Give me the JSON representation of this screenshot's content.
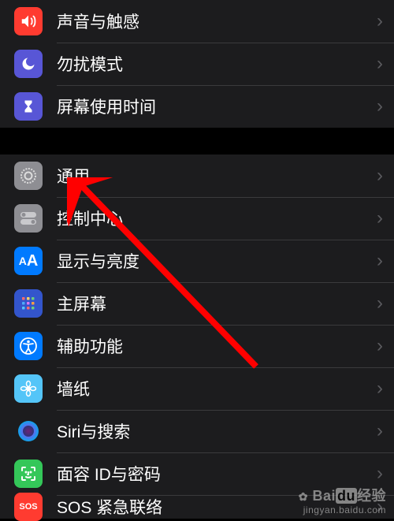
{
  "groups": [
    {
      "rows": [
        {
          "id": "sounds",
          "label": "声音与触感",
          "icon_bg": "#ff3b30"
        },
        {
          "id": "dnd",
          "label": "勿扰模式",
          "icon_bg": "#5856d6"
        },
        {
          "id": "screentime",
          "label": "屏幕使用时间",
          "icon_bg": "#5856d6"
        }
      ]
    },
    {
      "rows": [
        {
          "id": "general",
          "label": "通用",
          "icon_bg": "#8e8e93"
        },
        {
          "id": "controlcenter",
          "label": "控制中心",
          "icon_bg": "#8e8e93"
        },
        {
          "id": "display",
          "label": "显示与亮度",
          "icon_bg": "#007aff"
        },
        {
          "id": "homescreen",
          "label": "主屏幕",
          "icon_bg": "#3355cc"
        },
        {
          "id": "accessibility",
          "label": "辅助功能",
          "icon_bg": "#007aff"
        },
        {
          "id": "wallpaper",
          "label": "墙纸",
          "icon_bg": "#54c5f8"
        },
        {
          "id": "siri",
          "label": "Siri与搜索",
          "icon_bg": "#1c1c1e"
        },
        {
          "id": "faceid",
          "label": "面容 ID与密码",
          "icon_bg": "#34c759"
        },
        {
          "id": "sos",
          "label": "SOS 紧急联络",
          "icon_bg": "#ff3b30"
        }
      ]
    }
  ],
  "watermark": {
    "brand": "Bai",
    "du": "du",
    "suffix": "经验",
    "url": "jingyan.baidu.com"
  },
  "annotation": {
    "arrow_color": "#ff0000"
  }
}
